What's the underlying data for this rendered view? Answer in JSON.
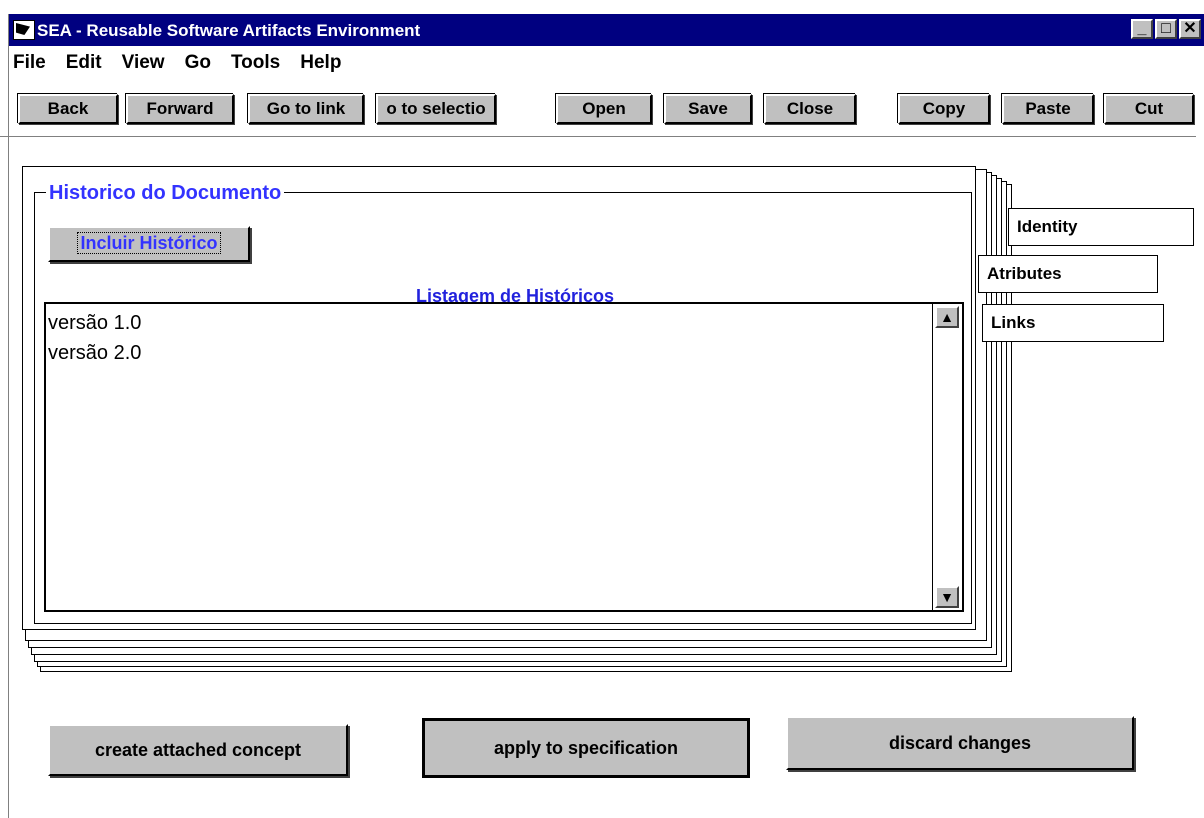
{
  "window": {
    "title": "SEA - Reusable Software Artifacts Environment",
    "controls": {
      "minimize": "_",
      "maximize": "□",
      "close": "✕"
    }
  },
  "menu": [
    "File",
    "Edit",
    "View",
    "Go",
    "Tools",
    "Help"
  ],
  "toolbar": [
    "Back",
    "Forward",
    "Go to link",
    "o to selectio",
    "Open",
    "Save",
    "Close",
    "Copy",
    "Paste",
    "Cut"
  ],
  "tabs": {
    "identity": "Identity",
    "atributes": "Atributes",
    "links": "Links"
  },
  "panel": {
    "title": "Historico do Documento",
    "include_button": "Incluir Histórico",
    "list_caption": "Listagem de Históricos",
    "list_items": [
      "versão 1.0",
      "versão 2.0"
    ]
  },
  "scroll": {
    "up": "▲",
    "down": "▼"
  },
  "actions": {
    "create": "create attached concept",
    "apply": "apply to specification",
    "discard": "discard changes"
  },
  "colors": {
    "titlebar": "#000080",
    "accent_text": "#3333ff",
    "button_face": "#c0c0c0"
  }
}
